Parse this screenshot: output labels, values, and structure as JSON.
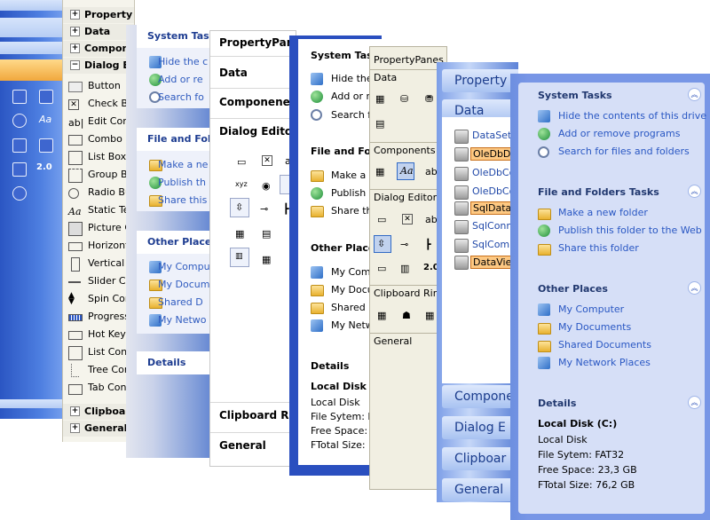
{
  "p1": {
    "icon_colors": [
      "#ffffff"
    ]
  },
  "p2": {
    "sections": [
      "Property P",
      "Data",
      "Compon",
      "Dialog E"
    ],
    "items": [
      "Button",
      "Check Bo",
      "Edit Cont",
      "Combo Bo",
      "List Box",
      "Group Bo",
      "Radio Bu",
      "Static Te",
      "Picture C",
      "Horizonta",
      "Vertical S",
      "Slider Con",
      "Spin Cont",
      "Progress",
      "Hot Key",
      "List Contr",
      "Tree Con",
      "Tab Contro"
    ],
    "footer": [
      "Clipboar",
      "General"
    ]
  },
  "p3": {
    "system_tasks": "System Task",
    "tasks": [
      "Hide the c",
      "Add or re",
      "Search fo"
    ],
    "file_folder": "File and Fold",
    "ff_items": [
      "Make a ne",
      "Publish th",
      "Share this"
    ],
    "other": "Other Places",
    "other_items": [
      "My Compu",
      "My Docum",
      "Shared D",
      "My Netwo"
    ],
    "details": "Details"
  },
  "p4": {
    "title": "PropertyPanes",
    "data": "Data",
    "components": "Componenent",
    "dialog": "Dialog Editor",
    "clipboard": "Clipboard Ring",
    "general": "General"
  },
  "p5": {
    "system_tasks": "System Tas",
    "tasks": [
      "Hide the",
      "Add or r",
      "Search fo"
    ],
    "file_folder": "File and Fol",
    "ff_items": [
      "Make a",
      "Publish th",
      "Share th"
    ],
    "other": "Other Place",
    "other_items": [
      "My Comp",
      "My Docu",
      "Shared D",
      "My Netw"
    ],
    "details": "Details",
    "disk": "Local Disk (",
    "disk_lines": [
      "Local Disk",
      "File Sytem: FA",
      "Free Space: 2",
      "FTotal Size: 7"
    ]
  },
  "p6": {
    "title": "PropertyPanes",
    "data": "Data",
    "components": "Components",
    "dialog": "Dialog Editor",
    "clipboard": "Clipboard Ring",
    "general": "General"
  },
  "p7": {
    "property": "Property",
    "data": "Data",
    "items": [
      "DataSet",
      "OleDbDa",
      "OleDbCo",
      "OleDbCo",
      "SqlDataA",
      "SqlConn",
      "SqlComm",
      "DataView"
    ],
    "components": "Compone",
    "dialog": "Dialog E",
    "clipboard": "Clipboar",
    "general": "General"
  },
  "p8": {
    "system_tasks": "System Tasks",
    "tasks": [
      "Hide the contents of this drive",
      "Add or remove programs",
      "Search for files and folders"
    ],
    "file_folder": "File and Folders Tasks",
    "ff_items": [
      "Make a new folder",
      "Publish this folder to the Web",
      "Share this folder"
    ],
    "other": "Other Places",
    "other_items": [
      "My Computer",
      "My Documents",
      "Shared Documents",
      "My Network Places"
    ],
    "details": "Details",
    "disk": "Local Disk (C:)",
    "disk_lines": [
      "Local Disk",
      "File Sytem: FAT32",
      "Free Space: 23,3 GB",
      "FTotal Size: 76,2 GB"
    ]
  },
  "colors": {
    "xp_blue": "#2b56c3",
    "link_blue": "#2957c3",
    "pane_bg": "#d6dff7",
    "selection": "#fdc882"
  }
}
